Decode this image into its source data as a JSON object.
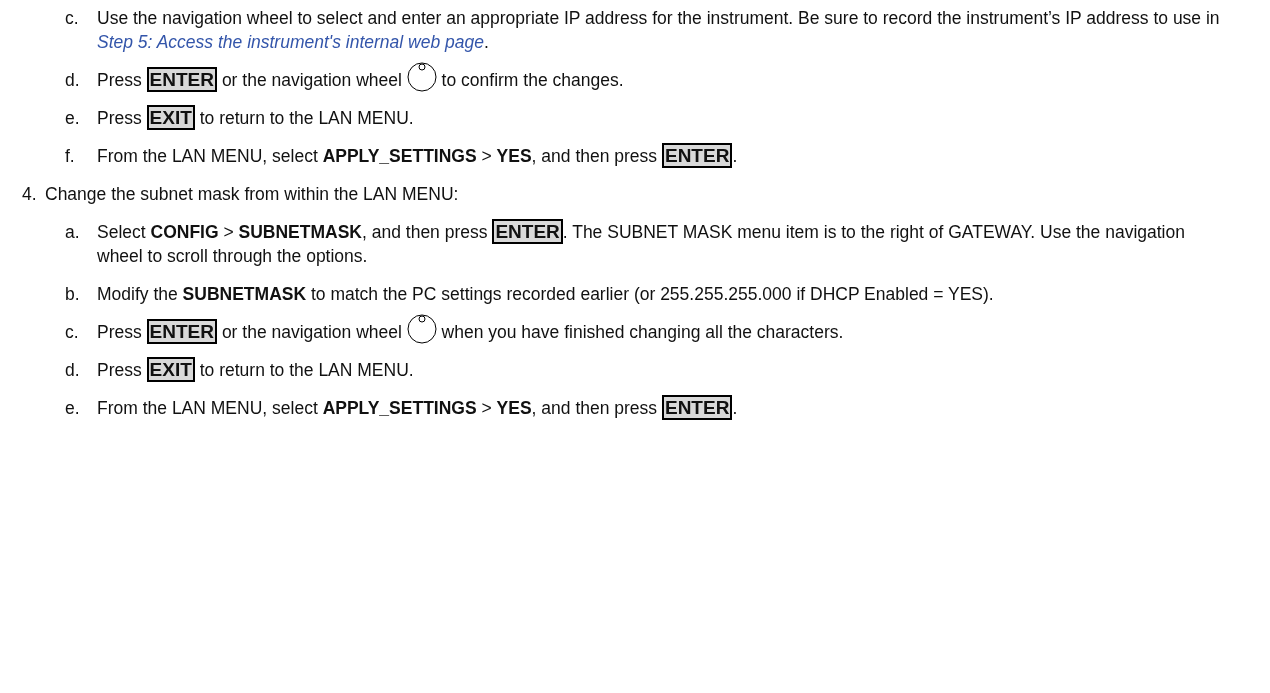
{
  "continued_substeps": [
    {
      "marker": "c.",
      "parts": [
        {
          "kind": "text",
          "text": "Use the navigation wheel to select and enter an appropriate IP address for the instrument. Be sure to record the instrument’s IP address to use in "
        },
        {
          "kind": "link",
          "text": "Step 5: Access the instrument's internal web page"
        },
        {
          "kind": "text",
          "text": "."
        }
      ]
    },
    {
      "marker": "d.",
      "parts": [
        {
          "kind": "text",
          "text": "Press "
        },
        {
          "kind": "key",
          "text": "ENTER"
        },
        {
          "kind": "text",
          "text": " or the navigation wheel "
        },
        {
          "kind": "wheel"
        },
        {
          "kind": "text",
          "text": " to confirm the changes."
        }
      ]
    },
    {
      "marker": "e.",
      "parts": [
        {
          "kind": "text",
          "text": "Press "
        },
        {
          "kind": "key",
          "text": "EXIT"
        },
        {
          "kind": "text",
          "text": " to return to the LAN MENU."
        }
      ]
    },
    {
      "marker": "f.",
      "parts": [
        {
          "kind": "text",
          "text": "From the LAN MENU, select **APPLY_SETTINGS** > **YES**, and then press "
        },
        {
          "kind": "key",
          "text": "ENTER"
        },
        {
          "kind": "text",
          "text": "."
        }
      ]
    }
  ],
  "steps": [
    {
      "marker": "4.",
      "parts": [
        {
          "kind": "text",
          "text": "Change the subnet mask from within the LAN MENU:"
        }
      ],
      "children": [
        {
          "marker": "a.",
          "parts": [
            {
              "kind": "text",
              "text": "Select **CONFIG** > **SUBNETMASK**, and then press "
            },
            {
              "kind": "key",
              "text": "ENTER"
            },
            {
              "kind": "text",
              "text": ". The SUBNET MASK menu item is to the right of GATEWAY. Use the navigation wheel to scroll through the options."
            }
          ]
        },
        {
          "marker": "b.",
          "parts": [
            {
              "kind": "text",
              "text": "Modify the **SUBNETMASK** to match the PC settings recorded earlier (or 255.255.255.000 if DHCP Enabled = YES)."
            }
          ]
        },
        {
          "marker": "c.",
          "parts": [
            {
              "kind": "text",
              "text": "Press "
            },
            {
              "kind": "key",
              "text": "ENTER"
            },
            {
              "kind": "text",
              "text": " or the navigation wheel "
            },
            {
              "kind": "wheel"
            },
            {
              "kind": "text",
              "text": " when you have finished changing all the characters."
            }
          ]
        },
        {
          "marker": "d.",
          "parts": [
            {
              "kind": "text",
              "text": "Press "
            },
            {
              "kind": "key",
              "text": "EXIT"
            },
            {
              "kind": "text",
              "text": " to return to the LAN MENU."
            }
          ]
        },
        {
          "marker": "e.",
          "parts": [
            {
              "kind": "text",
              "text": "From the LAN MENU, select **APPLY_SETTINGS** > **YES**, and then press "
            },
            {
              "kind": "key",
              "text": "ENTER"
            },
            {
              "kind": "text",
              "text": "."
            }
          ]
        }
      ]
    }
  ]
}
